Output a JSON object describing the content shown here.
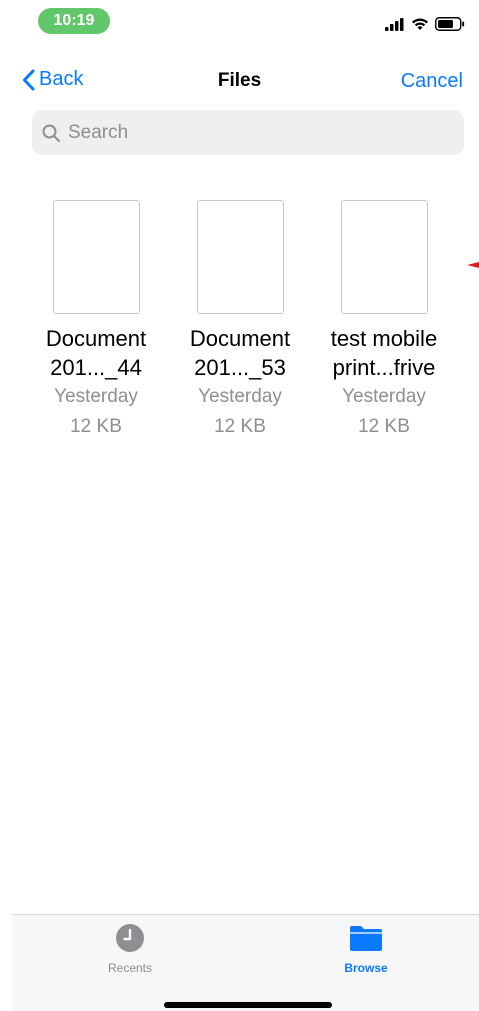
{
  "status_bar": {
    "time": "10:19",
    "icons": [
      "cellular-signal-icon",
      "wifi-icon",
      "battery-icon"
    ]
  },
  "nav": {
    "back_label": "Back",
    "title": "Files",
    "cancel_label": "Cancel"
  },
  "search": {
    "placeholder": "Search",
    "value": ""
  },
  "files": [
    {
      "name_line1": "Document",
      "name_line2": "201..._44",
      "date": "Yesterday",
      "size": "12 KB",
      "thumb_text": ""
    },
    {
      "name_line1": "Document",
      "name_line2": "201..._53",
      "date": "Yesterday",
      "size": "12 KB",
      "thumb_text": ""
    },
    {
      "name_line1": "test mobile",
      "name_line2": "print...frive",
      "date": "Yesterday",
      "size": "12 KB",
      "thumb_text": ""
    }
  ],
  "tabs": [
    {
      "label": "Recents",
      "icon": "clock-icon",
      "active": false
    },
    {
      "label": "Browse",
      "icon": "folder-icon",
      "active": true
    }
  ],
  "colors": {
    "accent": "#0a7aff",
    "time_pill": "#61c76a",
    "secondary_text": "#8e8e93",
    "marker": "#d0202a"
  }
}
